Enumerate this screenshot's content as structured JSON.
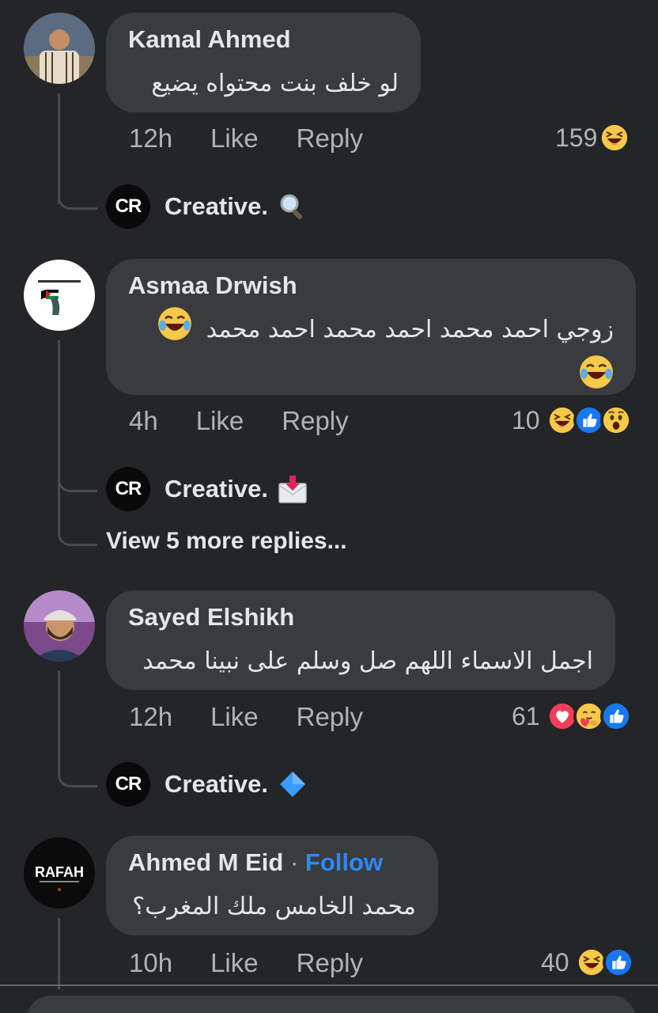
{
  "comments": [
    {
      "author": "Kamal Ahmed",
      "text": "لو خلف بنت محتواه يضيع",
      "time": "12h",
      "like_label": "Like",
      "reply_label": "Reply",
      "reaction_count": "159",
      "reactions": [
        "laugh"
      ],
      "page_reply": {
        "name": "Creative.",
        "logo": "CR",
        "emoji": "magnifier-icon"
      }
    },
    {
      "author": "Asmaa Drwish",
      "text_line1": "زوجي احمد محمد احمد محمد احمد محمد",
      "time": "4h",
      "like_label": "Like",
      "reply_label": "Reply",
      "reaction_count": "10",
      "reactions": [
        "laugh",
        "like",
        "wow"
      ],
      "page_reply": {
        "name": "Creative.",
        "logo": "CR",
        "emoji": "envelope-icon"
      },
      "more_replies": "View 5 more replies..."
    },
    {
      "author": "Sayed Elshikh",
      "text": "اجمل الاسماء اللهم صل وسلم على نبينا محمد",
      "time": "12h",
      "like_label": "Like",
      "reply_label": "Reply",
      "reaction_count": "61",
      "reactions": [
        "love",
        "care",
        "like"
      ],
      "page_reply": {
        "name": "Creative.",
        "logo": "CR",
        "emoji": "blue-diamond-icon"
      }
    },
    {
      "author": "Ahmed M Eid",
      "separator": " · ",
      "follow_label": "Follow",
      "avatar_text": "RAFAH",
      "text": "محمد الخامس ملك المغرب؟",
      "time": "10h",
      "like_label": "Like",
      "reply_label": "Reply",
      "reaction_count": "40",
      "reactions": [
        "laugh",
        "like"
      ]
    }
  ],
  "colors": {
    "background": "#242526",
    "bubble": "#3a3b3c",
    "text": "#e4e6eb",
    "muted": "#b0b3b8",
    "link": "#2d88ff"
  }
}
